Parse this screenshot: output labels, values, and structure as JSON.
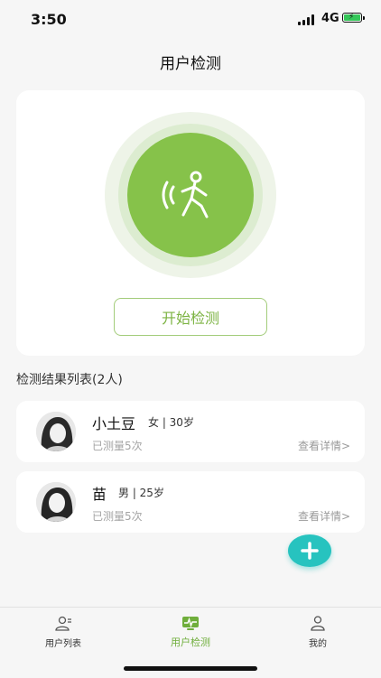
{
  "status_bar": {
    "time": "3:50",
    "network": "4G"
  },
  "header": {
    "title": "用户检测"
  },
  "detect": {
    "start_label": "开始检测"
  },
  "results": {
    "heading": "检测结果列表(2人)",
    "users": [
      {
        "name": "小土豆",
        "info": "女 | 30岁",
        "measured": "已测量5次",
        "details": "查看详情>"
      },
      {
        "name": "苗",
        "info": "男 | 25岁",
        "measured": "已测量5次",
        "details": "查看详情>"
      }
    ]
  },
  "tabbar": {
    "items": [
      {
        "label": "用户列表",
        "icon": "user-list-icon"
      },
      {
        "label": "用户检测",
        "icon": "monitor-icon",
        "active": true
      },
      {
        "label": "我的",
        "icon": "profile-icon"
      }
    ]
  },
  "colors": {
    "primary_green": "#86c24a",
    "accent_teal": "#27c3bf",
    "active_tab": "#6fae3b"
  }
}
